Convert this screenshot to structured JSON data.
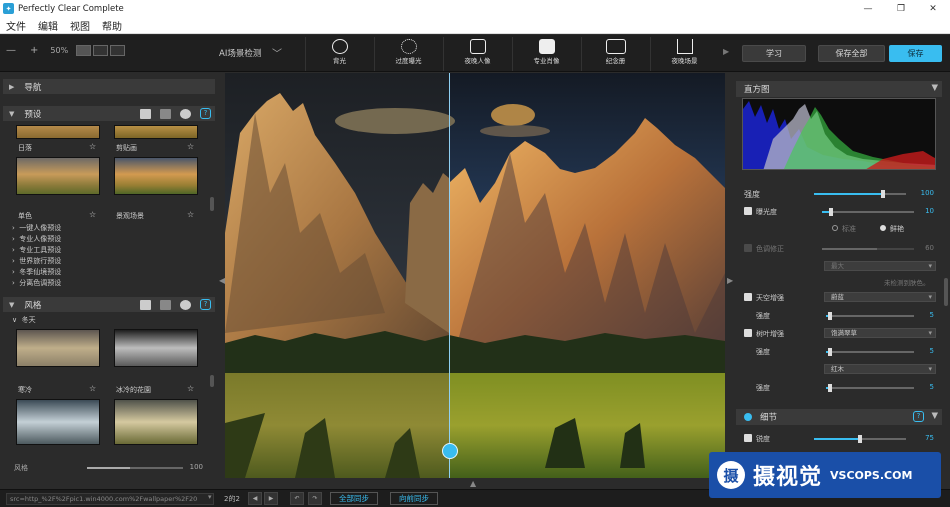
{
  "window": {
    "title": "Perfectly Clear Complete",
    "controls": [
      "—",
      "❐",
      "✕"
    ]
  },
  "menu": [
    "文件",
    "编辑",
    "视图",
    "帮助"
  ],
  "toolbar": {
    "zoom_minus": "—",
    "zoom_plus": "+",
    "zoom_level": "50%",
    "ai_scene_label": "AI场景检测",
    "scenes": [
      {
        "label": "背光",
        "icon": "backlight-icon"
      },
      {
        "label": "过度曝光",
        "icon": "sun-icon"
      },
      {
        "label": "夜晚人像",
        "icon": "group-portrait-icon"
      },
      {
        "label": "专业肖像",
        "icon": "portrait-icon"
      },
      {
        "label": "纪念册",
        "icon": "album-icon"
      },
      {
        "label": "夜晚场景",
        "icon": "night-scene-icon"
      }
    ],
    "buttons": {
      "learn": "学习",
      "save_all": "保存全部",
      "save": "保存"
    }
  },
  "left_panel": {
    "nav_title": "导航",
    "presets_title": "预设",
    "preset_thumbs": [
      {
        "label": "日落"
      },
      {
        "label": "剪贴画"
      },
      {
        "label": "单色"
      },
      {
        "label": "景观场景"
      }
    ],
    "preset_groups": [
      "一键人像预设",
      "专业人像预设",
      "专业工具预设",
      "世界旅行预设",
      "冬季仙境预设",
      "分离色调预设"
    ],
    "styles_title": "风格",
    "styles_group": "冬天",
    "style_thumbs": [
      {
        "label": "寒冷"
      },
      {
        "label": "冰冷的花園"
      }
    ],
    "styles_footer_label": "风格",
    "styles_footer_value": "100",
    "style_strength_fraction": 0.45
  },
  "statusbar": {
    "src": "src=http_%2F%2Fpic1.win4000.com%2Fwallpaper%2F20",
    "page": "2的2",
    "sync_all": "全部同步",
    "sync_forward": "向前同步"
  },
  "right_panel": {
    "histogram_title": "直方图",
    "strength": {
      "label": "强度",
      "value": "100",
      "fraction": 0.75
    },
    "exposure": {
      "label": "曝光度",
      "value": "10",
      "fraction": 0.1,
      "checked": true
    },
    "exposure_modes": {
      "standard": "标准",
      "bright": "鲜艳"
    },
    "color_correction": {
      "label": "色调修正",
      "value": "60",
      "fraction": 0.6,
      "checked": false
    },
    "color_dropdown": "最大",
    "no_skin": "未检测到肤色。",
    "sky": {
      "label": "天空增强",
      "dropdown": "蔚蓝",
      "sub_label": "强度",
      "value": "5",
      "fraction": 0.05,
      "checked": true
    },
    "foliage": {
      "label": "树叶增强",
      "dropdown": "饱满翠草",
      "sub_label": "强度",
      "value": "5",
      "fraction": 0.05,
      "checked": true,
      "dropdown2": "红木",
      "sub_label2": "强度",
      "value2": "5",
      "fraction2": 0.05
    },
    "details_title": "细节",
    "sharpen": {
      "label": "锐度",
      "value": "75",
      "fraction": 0.5,
      "checked": true
    }
  },
  "watermark": {
    "logo": "摄",
    "cn": "摄视觉",
    "en": "VSCOPS.COM"
  }
}
